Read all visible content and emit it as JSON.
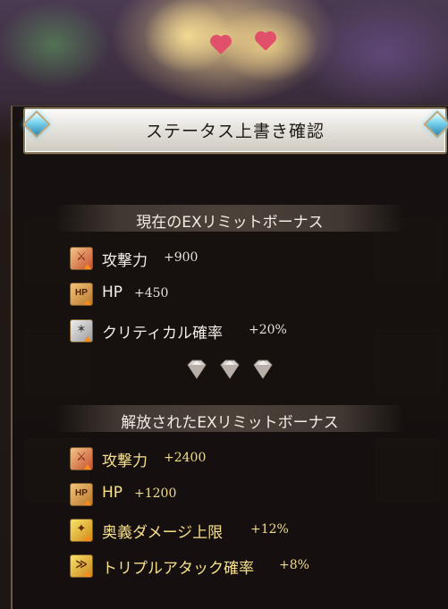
{
  "dialog": {
    "title": "ステータス上書き確認"
  },
  "current_section": {
    "title": "現在のEXリミットボーナス",
    "items": [
      {
        "label": "攻撃力",
        "value": "+900",
        "icon": "attack-up-icon"
      },
      {
        "label": "HP",
        "value": "+450",
        "icon": "hp-up-icon"
      },
      {
        "label": "クリティカル確率",
        "value": "+20%",
        "icon": "critical-up-icon"
      }
    ]
  },
  "released_section": {
    "title": "解放されたEXリミットボーナス",
    "items": [
      {
        "label": "攻撃力",
        "value": "+2400",
        "icon": "attack-up-icon"
      },
      {
        "label": "HP",
        "value": "+1200",
        "icon": "hp-up-icon"
      },
      {
        "label": "奥義ダメージ上限",
        "value": "+12%",
        "icon": "ougi-cap-up-icon"
      },
      {
        "label": "トリプルアタック確率",
        "value": "+8%",
        "icon": "triple-attack-up-icon"
      }
    ]
  },
  "icons": {
    "hp_badge": "HP",
    "divider": "down-diamond-arrows"
  },
  "colors": {
    "released_text": "#f6e08a",
    "current_text": "#f2ede6",
    "gem": "#7fd6f0"
  }
}
